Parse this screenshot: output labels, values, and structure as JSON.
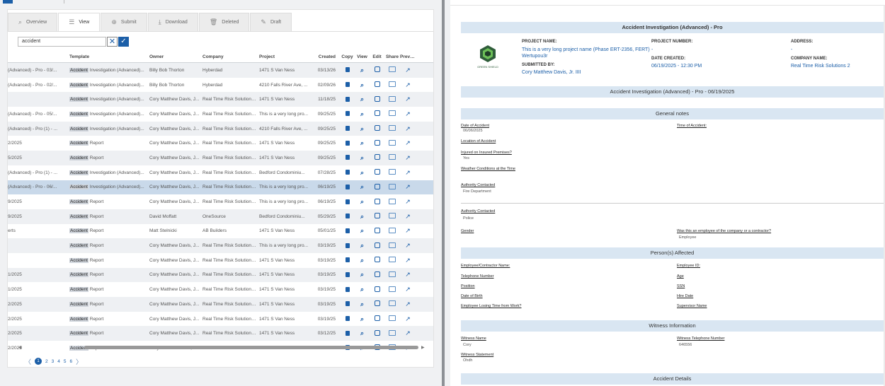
{
  "tabs": [
    {
      "label": "Overview",
      "icon": "search-icon",
      "glyph": "⌕"
    },
    {
      "label": "View",
      "icon": "list-icon",
      "glyph": "☰"
    },
    {
      "label": "Submit",
      "icon": "plus-circle-icon",
      "glyph": "⊕"
    },
    {
      "label": "Download",
      "icon": "download-icon",
      "glyph": "⤓"
    },
    {
      "label": "Deleted",
      "icon": "trash-icon",
      "glyph": "🗑"
    },
    {
      "label": "Draft",
      "icon": "pencil-icon",
      "glyph": "✎"
    }
  ],
  "search": {
    "value": "accident",
    "clear": "✕",
    "confirm": "✓"
  },
  "table": {
    "headers": [
      "",
      "Template",
      "Owner",
      "Company",
      "Project",
      "Created",
      "Copy",
      "View",
      "Edit",
      "Share",
      "Preview"
    ],
    "rows": [
      {
        "name": "(Advanced) - Pro - 03/...",
        "hl": "Accident",
        "tpl": "Investigation (Advanced)...",
        "owner": "Billy Bob Thorton",
        "company": "Hyberdad",
        "project": "1471 S Van Ness",
        "created": "03/13/26"
      },
      {
        "name": "(Advanced) - Pro - 02/...",
        "hl": "Accident",
        "tpl": "Investigation (Advanced)...",
        "owner": "Billy Bob Thorton",
        "company": "Hyberdad",
        "project": "4210 Falls River Ave, ...",
        "created": "02/09/26"
      },
      {
        "name": "",
        "hl": "Accident",
        "tpl": "Investigation (Advanced)...",
        "owner": "Cory Matthew Davis, J...",
        "company": "Real Time Risk Solutions 2",
        "project": "1471 S Van Ness",
        "created": "11/18/25"
      },
      {
        "name": "(Advanced) - Pro - 05/...",
        "hl": "Accident",
        "tpl": "Investigation (Advanced)...",
        "owner": "Cory Matthew Davis, J...",
        "company": "Real Time Risk Solutions 2",
        "project": "This is a very long pro...",
        "created": "09/25/25"
      },
      {
        "name": "(Advanced) - Pro (1) - ...",
        "hl": "Accident",
        "tpl": "Investigation (Advanced)...",
        "owner": "Cory Matthew Davis, J...",
        "company": "Real Time Risk Solutions 2",
        "project": "4210 Falls River Ave, ...",
        "created": "09/25/25"
      },
      {
        "name": "2/2025",
        "hl": "Accident",
        "tpl": "Report",
        "owner": "Cory Matthew Davis, J...",
        "company": "Real Time Risk Solutions 2",
        "project": "1471 S Van Ness",
        "created": "09/25/25"
      },
      {
        "name": "5/2025",
        "hl": "Accident",
        "tpl": "Report",
        "owner": "Cory Matthew Davis, J...",
        "company": "Real Time Risk Solutions 2",
        "project": "1471 S Van Ness",
        "created": "09/25/25"
      },
      {
        "name": "(Advanced) - Pro (1) - ...",
        "hl": "Accident",
        "tpl": "Investigation (Advanced)...",
        "owner": "Cory Matthew Davis, J...",
        "company": "Real Time Risk Solutions 2",
        "project": "Bedford Condominiu...",
        "created": "07/28/25"
      },
      {
        "name": "(Advanced) - Pro - 06/...",
        "hl": "Accident",
        "tpl": "Investigation (Advanced)...",
        "owner": "Cory Matthew Davis, J...",
        "company": "Real Time Risk Solutions 2",
        "project": "This is a very long pro...",
        "created": "06/19/25"
      },
      {
        "name": "9/2025",
        "hl": "Accident",
        "tpl": "Report",
        "owner": "Cory Matthew Davis, J...",
        "company": "Real Time Risk Solutions 2",
        "project": "This is a very long pro...",
        "created": "06/19/25"
      },
      {
        "name": "9/2025",
        "hl": "Accident",
        "tpl": "Report",
        "owner": "David Moffatt",
        "company": "OneSource",
        "project": "Bedford Condominiu...",
        "created": "05/29/25"
      },
      {
        "name": "erts",
        "hl": "Accident",
        "tpl": "Report",
        "owner": "Matt Stelnicki",
        "company": "AB Builders",
        "project": "1471 S Van Ness",
        "created": "05/01/25"
      },
      {
        "name": "",
        "hl": "Accident",
        "tpl": "Report",
        "owner": "Cory Matthew Davis, J...",
        "company": "Real Time Risk Solutions 2",
        "project": "This is a very long pro...",
        "created": "03/19/25"
      },
      {
        "name": "",
        "hl": "Accident",
        "tpl": "Report",
        "owner": "Cory Matthew Davis, J...",
        "company": "Real Time Risk Solutions 2",
        "project": "1471 S Van Ness",
        "created": "03/19/25"
      },
      {
        "name": "1/2025",
        "hl": "Accident",
        "tpl": "Report",
        "owner": "Cory Matthew Davis, J...",
        "company": "Real Time Risk Solutions 2",
        "project": "1471 S Van Ness",
        "created": "03/19/25"
      },
      {
        "name": "1/2025",
        "hl": "Accident",
        "tpl": "Report",
        "owner": "Cory Matthew Davis, J...",
        "company": "Real Time Risk Solutions 2",
        "project": "1471 S Van Ness",
        "created": "03/19/25"
      },
      {
        "name": "2/2025",
        "hl": "Accident",
        "tpl": "Report",
        "owner": "Cory Matthew Davis, J...",
        "company": "Real Time Risk Solutions 2",
        "project": "1471 S Van Ness",
        "created": "03/19/25"
      },
      {
        "name": "2/2025",
        "hl": "Accident",
        "tpl": "Report",
        "owner": "Cory Matthew Davis, J...",
        "company": "Real Time Risk Solutions 2",
        "project": "1471 S Van Ness",
        "created": "03/19/25"
      },
      {
        "name": "2/2025",
        "hl": "Accident",
        "tpl": "Report",
        "owner": "Cory Matthew Davis, J...",
        "company": "Real Time Risk Solutions 2",
        "project": "1471 S Van Ness",
        "created": "03/12/25"
      },
      {
        "name": "2/2025",
        "hl": "Accident",
        "tpl": "Report",
        "owner": "Cory Matthew Davis, J...",
        "company": "Real Time Risk Solutions 2",
        "project": "1471 S Van Ness",
        "created": "03/12/25"
      }
    ],
    "selected_row": 8,
    "action_icons": [
      "copy-icon",
      "view-icon",
      "edit-icon",
      "share-icon",
      "preview-icon"
    ]
  },
  "pager": {
    "prev": "〈",
    "pages": [
      "1",
      "2",
      "3",
      "4",
      "5",
      "6"
    ],
    "current": "1",
    "next": "〉"
  },
  "colors": {
    "accent": "#1c5fa8",
    "header_bar": "#d9e6f2",
    "selected_row": "#c9d9ea",
    "alt_row": "#eef0f3"
  },
  "preview": {
    "title": "Accident Investigation (Advanced) - Pro",
    "logo_text": "GREEN SHIELD",
    "project_name_label": "PROJECT NAME:",
    "project_name": "This is a very long project name (Phase ERT-2356, FERT) Wertupou3r",
    "project_number_label": "PROJECT NUMBER:",
    "project_number": "-",
    "address_label": "ADDRESS:",
    "address": "-",
    "date_created_label": "DATE CREATED:",
    "date_created": "06/19/2025 - 12:30 PM",
    "company_label": "COMPANY NAME:",
    "company": "Real Time Risk Solutions 2",
    "submitted_label": "SUBMITTED BY:",
    "submitted": "Cory Matthew Davis, Jr. IIII",
    "subtitle": "Accident Investigation (Advanced) - Pro - 06/19/2025",
    "general_notes": "General notes",
    "date_of_accident_label": "Date of Accident",
    "date_of_accident": "06/06/2025",
    "time_of_accident_label": "Time of Accident:",
    "location_label": "Location of Accident",
    "injured_label": "Injured on Insured Premises?",
    "injured": "Yes",
    "weather_label": "Weather Conditions at the Time",
    "authority1_label": "Authority Contacted",
    "authority1": "Fire Department",
    "authority2_label": "Authority Contacted",
    "authority2": "Police",
    "gender_label": "Gender",
    "employee_q_label": "Was this an employee of the company or a contractor?",
    "employee_q": "Employee",
    "persons_affected": "Person(s) Affected",
    "emp_name_label": "Employee/Contractor Name:",
    "emp_id_label": "Employee ID:",
    "phone_label": "Telephone Number",
    "age_label": "Age",
    "position_label": "Position",
    "ssn_label": "SSN",
    "dob_label": "Date of Birth",
    "hire_label": "Hire Date",
    "losing_time_label": "Employee Losing Time from Work?",
    "supervisor_label": "Supervisor Name",
    "witness_info": "Witness Information",
    "witness_name_label": "Witness Name",
    "witness_name": "Cory",
    "witness_phone_label": "Witness Telephone Number",
    "witness_phone": "646556",
    "witness_stmt_label": "Witness Statement",
    "witness_stmt": "Ohdh",
    "accident_details": "Accident Details"
  }
}
